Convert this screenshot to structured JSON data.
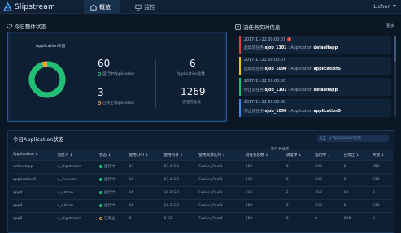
{
  "app": {
    "name": "Slipstream",
    "user": "Licher"
  },
  "nav": [
    {
      "label": "概览"
    },
    {
      "label": "监控"
    }
  ],
  "overview": {
    "title": "今日整体状态",
    "donut_label": "Application状态",
    "metrics": {
      "running": "60",
      "running_label": "运行中Application",
      "stopped": "3",
      "stopped_label": "已停止Application",
      "apps": "6",
      "apps_label": "Application总数",
      "tasks": "1269",
      "tasks_label": "流任务总数"
    },
    "colors": {
      "running": "#1fbf76",
      "stopped": "#f0a23a"
    },
    "running_fraction": 0.952
  },
  "feed": {
    "title": "流任务实时信息",
    "more": "更多",
    "alert_badge": "!",
    "items": [
      {
        "time": "2017-11-22 00:00:07",
        "action": "启动流任务",
        "job": "sjob_1101",
        "app_word": "Application",
        "app": "defaultapp",
        "color": "red"
      },
      {
        "time": "2017-11-22 00:00:07",
        "action": "启动流任务",
        "job": "sjob_1090",
        "app_word": "Application",
        "app": "application5",
        "color": "yellow"
      },
      {
        "time": "2017-11-22 00:00:00",
        "action": "停止流任务",
        "job": "sjob_1101",
        "app_word": "Application",
        "app": "defaultapp",
        "color": "green"
      },
      {
        "time": "2017-11-22 00:00:00",
        "action": "停止流任务",
        "job": "sjob_1090",
        "app_word": "Application",
        "app": "application5",
        "color": "blue"
      }
    ]
  },
  "table": {
    "title": "今日Application状态",
    "search_placeholder": "Q Application名称",
    "group_header": "流任务状态",
    "headers": [
      "Application ↓",
      "创建人 ↓",
      "状态 ↓",
      "使用CPU ↓",
      "使用内存 ↓",
      "使用资源队列 ↓",
      "流任务总数 ↓",
      "调度中 ↓",
      "运行中 ↓",
      "已停止 ↓",
      "失败 ↓"
    ],
    "rows": [
      [
        "defaultapp",
        "u_slipstream",
        "运行中",
        "23",
        "23.0 GB",
        "Fusion_Pool1",
        "252",
        "0",
        "230",
        "2",
        "252"
      ],
      [
        "application5",
        "u_inventor",
        "运行中",
        "10",
        "17.0 GB",
        "Fusion_Pool1",
        "230",
        "0",
        "230",
        "0",
        "230"
      ],
      [
        "app4",
        "u_admin",
        "运行中",
        "16",
        "18.0 GB",
        "Fusion_Pool1",
        "212",
        "2",
        "212",
        "10",
        "0"
      ],
      [
        "app3",
        "u_admin",
        "运行中",
        "16",
        "18.0 GB",
        "Fusion_Pool1",
        "280",
        "0",
        "230",
        "0",
        "230"
      ],
      [
        "app2",
        "u_slipstream",
        "已停止",
        "0",
        "0 GB",
        "Fusion_Pool4",
        "280",
        "0",
        "0",
        "280",
        "0"
      ]
    ]
  }
}
